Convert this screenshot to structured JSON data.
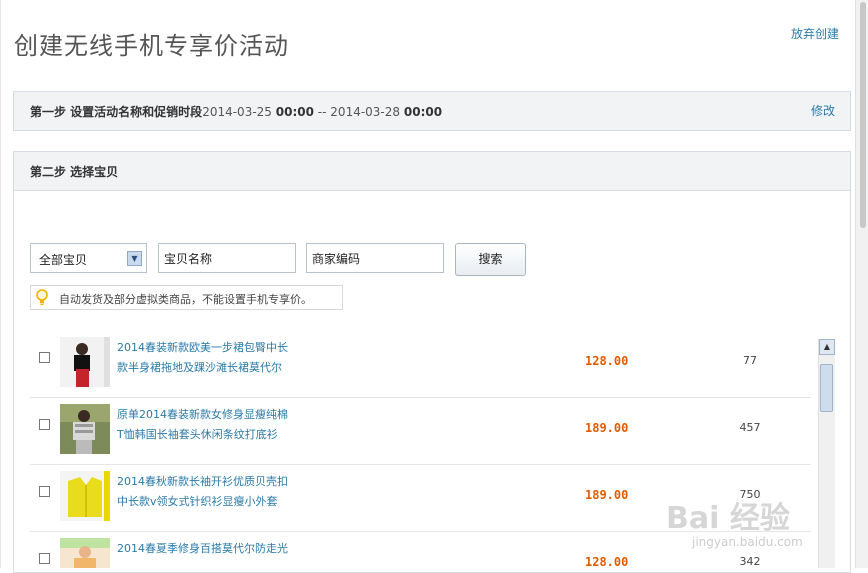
{
  "page": {
    "title": "创建无线手机专享价活动",
    "abandon_label": "放弃创建"
  },
  "step1": {
    "label": "第一步  设置活动名称和促销时段",
    "start_date": "2014-03-25",
    "start_time": "00:00",
    "separator": "--",
    "end_date": "2014-03-28",
    "end_time": "00:00",
    "modify_label": "修改"
  },
  "step2": {
    "label": "第二步  选择宝贝"
  },
  "filters": {
    "category_selected": "全部宝贝",
    "name_value": "宝贝名称",
    "code_value": "商家编码",
    "search_label": "搜索"
  },
  "notice": {
    "text": "自动发货及部分虚拟类商品，不能设置手机专享价。"
  },
  "products": [
    {
      "line1": "2014春装新款欧美一步裙包臀中长",
      "line2": "款半身裙拖地及踝沙滩长裙莫代尔",
      "price": "128.00",
      "stock": "77"
    },
    {
      "line1": "原单2014春装新款女修身显瘦纯棉",
      "line2": "T恤韩国长袖套头休闲条纹打底衫",
      "price": "189.00",
      "stock": "457"
    },
    {
      "line1": "2014春秋新款长袖开衫优质贝壳扣",
      "line2": "中长款v领女式针织衫显瘦小外套",
      "price": "189.00",
      "stock": "750"
    },
    {
      "line1": "2014春夏季修身百搭莫代尔防走光",
      "line2": "",
      "price": "128.00",
      "stock": "342"
    }
  ],
  "watermark": {
    "main": "Bai 经验",
    "sub": "jingyan.baidu.com"
  },
  "colors": {
    "link": "#2a7aa8",
    "price": "#e05a00",
    "panel_bg": "#f1f3f5",
    "border": "#d6dbe1"
  },
  "icons": {
    "notice": "lightbulb-icon",
    "select": "chevron-down-icon",
    "scroll": "chevron-up-icon"
  }
}
